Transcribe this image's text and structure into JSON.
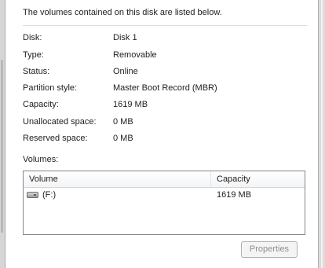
{
  "intro": "The volumes contained on this disk are listed below.",
  "fields": [
    {
      "label": "Disk:",
      "value": "Disk 1"
    },
    {
      "label": "Type:",
      "value": "Removable"
    },
    {
      "label": "Status:",
      "value": "Online"
    },
    {
      "label": "Partition style:",
      "value": "Master Boot Record (MBR)"
    },
    {
      "label": "Capacity:",
      "value": "1619 MB"
    },
    {
      "label": "Unallocated space:",
      "value": "0 MB"
    },
    {
      "label": "Reserved space:",
      "value": "0 MB"
    }
  ],
  "volumes": {
    "title": "Volumes:",
    "columns": [
      "Volume",
      "Capacity"
    ],
    "rows": [
      {
        "icon": "drive-icon",
        "volume": "(F:)",
        "capacity": "1619 MB"
      }
    ]
  },
  "buttons": {
    "properties": "Properties"
  }
}
